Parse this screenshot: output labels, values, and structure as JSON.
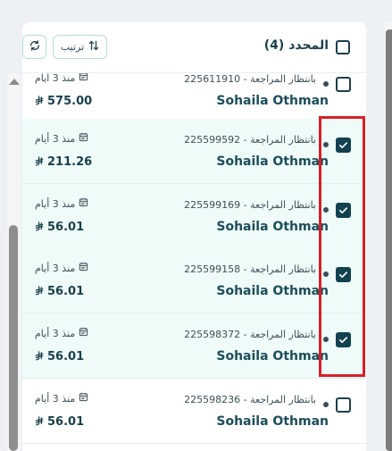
{
  "header": {
    "select_all_label": "المحدد (4)",
    "sort_label": "ترتيب"
  },
  "rows": [
    {
      "status": "بانتظار المراجعة - 225611910",
      "name": "Sohaila Othman",
      "time": "منذ 3 أيام",
      "amount": "575.00",
      "checked": false
    },
    {
      "status": "بانتظار المراجعة - 225599592",
      "name": "Sohaila Othman",
      "time": "منذ 3 أيام",
      "amount": "211.26",
      "checked": true
    },
    {
      "status": "بانتظار المراجعة - 225599169",
      "name": "Sohaila Othman",
      "time": "منذ 3 أيام",
      "amount": "56.01",
      "checked": true
    },
    {
      "status": "بانتظار المراجعة - 225599158",
      "name": "Sohaila Othman",
      "time": "منذ 3 أيام",
      "amount": "56.01",
      "checked": true
    },
    {
      "status": "بانتظار المراجعة - 225598372",
      "name": "Sohaila Othman",
      "time": "منذ 3 أيام",
      "amount": "56.01",
      "checked": true
    },
    {
      "status": "بانتظار المراجعة - 225598236",
      "name": "Sohaila Othman",
      "time": "منذ 3 أيام",
      "amount": "56.01",
      "checked": false
    }
  ],
  "icons": {
    "refresh": "refresh-icon",
    "sort": "sort-arrows-icon",
    "calendar": "calendar-icon",
    "currency": "riyal-icon",
    "check": "check-icon"
  },
  "colors": {
    "selected_row_bg": "#effbf9",
    "checkbox_checked": "#12414f",
    "highlight_border": "#d91f26",
    "button_border": "#b6dfda"
  }
}
